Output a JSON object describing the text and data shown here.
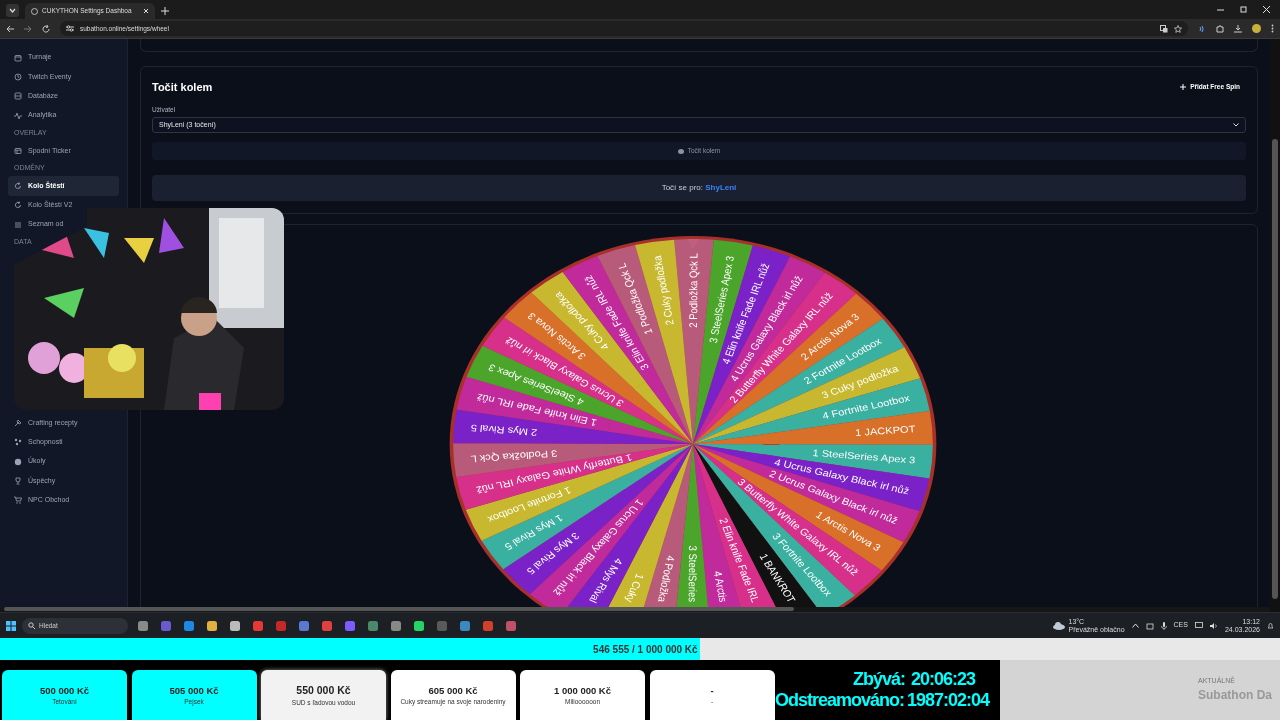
{
  "browser": {
    "tab": {
      "title": "CUKYTHON Settings Dashboa",
      "selected": true
    },
    "url": "subathon.online/settings/wheel"
  },
  "sidebar": {
    "top_items": [
      {
        "kind": "link",
        "label": "Turnaje",
        "selected": false
      },
      {
        "kind": "link",
        "label": "Twitch Eventy",
        "selected": false
      },
      {
        "kind": "link",
        "label": "Databáze",
        "selected": false
      },
      {
        "kind": "link",
        "label": "Analytika",
        "selected": false
      },
      {
        "kind": "heading",
        "label": "OVERLAY"
      },
      {
        "kind": "link",
        "label": "Spodní Ticker",
        "selected": false
      },
      {
        "kind": "heading",
        "label": "ODMĚNY"
      },
      {
        "kind": "link",
        "label": "Kolo Štěstí",
        "selected": true
      },
      {
        "kind": "link",
        "label": "Kolo Štěstí V2",
        "selected": false
      },
      {
        "kind": "link",
        "label": "Seznam od",
        "selected": false
      },
      {
        "kind": "heading",
        "label": "DATA"
      }
    ],
    "bottom_items": [
      {
        "kind": "link",
        "label": "Crafting recepty",
        "selected": false
      },
      {
        "kind": "link",
        "label": "Schopnosti",
        "selected": false
      },
      {
        "kind": "link",
        "label": "Úkoly",
        "selected": false
      },
      {
        "kind": "link",
        "label": "Úspěchy",
        "selected": false
      },
      {
        "kind": "link",
        "label": "NPC Obchod",
        "selected": false
      }
    ]
  },
  "wheel_panel": {
    "title": "Točit kolem",
    "add_button": "Přidat Free Spin",
    "user_label": "Uživatel",
    "user_value": "ShyLeni (3 točení)",
    "spin_button": "Točit kolem",
    "spinning_for_label": "Točí se pro:",
    "spinning_for_user": "ShyLeni"
  },
  "wheel": {
    "segments": [
      {
        "label": "2 Podložka Qck L",
        "color": "#b85a7a"
      },
      {
        "label": "3 SteelSeries Apex 3",
        "color": "#4aa52a"
      },
      {
        "label": "4 Elin knife Fade IRL nůž",
        "color": "#7a22c8"
      },
      {
        "label": "4 Ucrus Galaxy Black irl nůž",
        "color": "#c02a9a"
      },
      {
        "label": "2 Butterfly White Galaxy IRL nůž",
        "color": "#d6308a"
      },
      {
        "label": "2 Arctis Nova 3",
        "color": "#d8702a"
      },
      {
        "label": "2 Fortnite Lootbox",
        "color": "#3ab0a0"
      },
      {
        "label": "3 Cuky podložka",
        "color": "#c8b830"
      },
      {
        "label": "4 Fortnite Lootbox",
        "color": "#3ab0a0"
      },
      {
        "label": "1 JACKPOT",
        "color": "#d8702a"
      },
      {
        "label": "1 SteelSeries Apex 3",
        "color": "#3ab0a0"
      },
      {
        "label": "4 Ucrus Galaxy Black irl nůž",
        "color": "#7a22c8"
      },
      {
        "label": "2 Ucrus Galaxy Black irl nůž",
        "color": "#c02a9a"
      },
      {
        "label": "1 Arctis Nova 3",
        "color": "#d8702a"
      },
      {
        "label": "3 Butterfly White Galaxy IRL nůž",
        "color": "#d6308a"
      },
      {
        "label": "3 Fortnite Lootbox",
        "color": "#3ab0a0"
      },
      {
        "label": "1 BANKROT",
        "color": "#111111"
      },
      {
        "label": "2 Elin knife Fade IRL",
        "color": "#d6308a"
      },
      {
        "label": "4 Arctis",
        "color": "#c02a9a"
      },
      {
        "label": "3 SteelSeries",
        "color": "#4aa52a"
      },
      {
        "label": "4 Podložka",
        "color": "#b85a7a"
      },
      {
        "label": "1 Cuky",
        "color": "#c8b830"
      },
      {
        "label": "4 Mys Rival",
        "color": "#7a22c8"
      },
      {
        "label": "1 Ucrus Galaxy Black irl nůž",
        "color": "#c02a9a"
      },
      {
        "label": "3 Mys Rival 5",
        "color": "#7a22c8"
      },
      {
        "label": "1 Mys Rival 5",
        "color": "#3ab0a0"
      },
      {
        "label": "1 Fortnite Lootbox",
        "color": "#c8b830"
      },
      {
        "label": "1 Butterfly White Galaxy IRL nůž",
        "color": "#d6308a"
      },
      {
        "label": "3 Podložka Qck L",
        "color": "#b85a7a"
      },
      {
        "label": "2 Mys Rival 5",
        "color": "#7a22c8"
      },
      {
        "label": "1 Elin knife Fade IRL nůž",
        "color": "#c02a9a"
      },
      {
        "label": "4 SteelSeries Apex 3",
        "color": "#4aa52a"
      },
      {
        "label": "3 Ucrus Galaxy Black irl nůž",
        "color": "#d6308a"
      },
      {
        "label": "3 Arctis Nova 3",
        "color": "#d8702a"
      },
      {
        "label": "4 Cuky podložka",
        "color": "#c8b830"
      },
      {
        "label": "3 Elin knife Fade IRL nůž",
        "color": "#c02a9a"
      },
      {
        "label": "1 Podložka Qck L",
        "color": "#b85a7a"
      },
      {
        "label": "2 Cuky podložka",
        "color": "#c8b830"
      }
    ]
  },
  "taskbar": {
    "search_placeholder": "Hledat",
    "weather_temp": "13°C",
    "weather_text": "Převážně oblačno",
    "language": "CES",
    "time": "13:12",
    "date": "24.03.2026"
  },
  "overlay": {
    "progress": {
      "level": 0.5466,
      "text": "546 555 / 1 000 000 Kč"
    },
    "goals": [
      {
        "amount": "500 000 Kč",
        "label": "Tetování",
        "reached": true,
        "current": false
      },
      {
        "amount": "505 000 Kč",
        "label": "Pejsek",
        "reached": true,
        "current": false
      },
      {
        "amount": "550 000 Kč",
        "label": "SUD s ľadovou vodou",
        "reached": false,
        "current": true
      },
      {
        "amount": "605 000 Kč",
        "label": "Cuky streamuje na svoje narodeniny",
        "reached": false,
        "current": false
      },
      {
        "amount": "1 000 000 Kč",
        "label": "Milioooooon",
        "reached": false,
        "current": false
      },
      {
        "amount": "-",
        "label": "-",
        "reached": false,
        "current": false
      }
    ],
    "remaining_label": "Zbývá:",
    "remaining": "20:06:23",
    "streamed_label": "Odstreamováno:",
    "streamed": "1987:02:04",
    "now_label": "AKTUÁLNĚ",
    "now_text": "Subathon Da"
  }
}
